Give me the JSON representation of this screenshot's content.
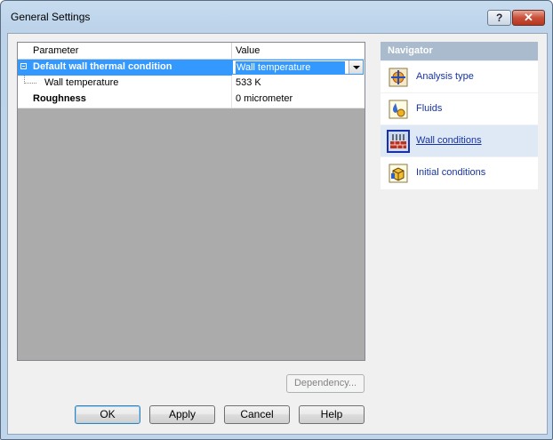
{
  "window": {
    "title": "General Settings",
    "help_label": "?",
    "close_label": "✕"
  },
  "grid": {
    "headers": [
      "Parameter",
      "Value"
    ],
    "rows": [
      {
        "parameter": "Default wall thermal condition",
        "value": "Wall temperature",
        "selected": true,
        "expanded": true
      },
      {
        "parameter": "Wall temperature",
        "value": "533 K"
      },
      {
        "parameter": "Roughness",
        "value": "0 micrometer"
      }
    ]
  },
  "navigator": {
    "title": "Navigator",
    "items": [
      {
        "label": "Analysis type",
        "icon": "analysis-type-icon"
      },
      {
        "label": "Fluids",
        "icon": "fluids-icon"
      },
      {
        "label": "Wall conditions",
        "icon": "wall-conditions-icon",
        "active": true
      },
      {
        "label": "Initial conditions",
        "icon": "initial-conditions-icon"
      }
    ]
  },
  "buttons": {
    "dependency": "Dependency...",
    "ok": "OK",
    "apply": "Apply",
    "cancel": "Cancel",
    "help": "Help"
  },
  "colors": {
    "selection": "#3399ff",
    "navigator_header": "#a9bbcc",
    "link": "#1533a5"
  }
}
